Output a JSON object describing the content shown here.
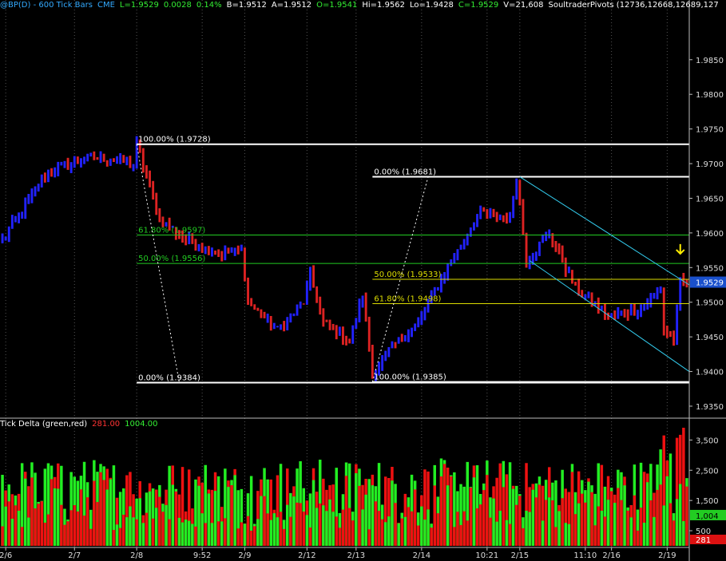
{
  "header": {
    "symbol": "@BP(D) - 600 Tick Bars",
    "exchange": "CME",
    "last": "L=1.9529",
    "change": "0.0028",
    "change_pct": "0.14%",
    "bid": "B=1.9512",
    "ask": "A=1.9512",
    "open": "O=1.9541",
    "high": "Hi=1.9562",
    "low": "Lo=1.9428",
    "close": "C=1.9529",
    "volume": "V=21,608",
    "pivots": "SoultraderPivots (12736,12668,12689,127"
  },
  "indicator_header": {
    "name": "Tick Delta (green,red)",
    "red_value": "281.00",
    "green_value": "1004.00"
  },
  "colors": {
    "up_bar": "#2222ff",
    "down_bar": "#dd2222",
    "delta_green": "#22ee22",
    "delta_red": "#ee1111",
    "white_line": "#ffffff",
    "green_line": "#22cc22",
    "yellow_line": "#dddd00",
    "channel": "#33ccee",
    "arrow": "#ffee00"
  },
  "chart_data": [
    {
      "type": "bar",
      "title": "@BP(D) - 600 Tick Bars",
      "ylim": [
        1.9335,
        1.992
      ],
      "y_ticks": [
        "1.9850",
        "1.9800",
        "1.9750",
        "1.9700",
        "1.9650",
        "1.9600",
        "1.9550",
        "1.9500",
        "1.9450",
        "1.9400",
        "1.9350"
      ],
      "last_price_tag": "1.9529",
      "x_ticks": [
        "2/6",
        "2/7",
        "2/8",
        "9:52",
        "2/9",
        "2/12",
        "2/13",
        "2/14",
        "10:21",
        "2/15",
        "11:10",
        "2/16",
        "2/19"
      ],
      "anchors": [
        {
          "bar": 0,
          "price": 1.959
        },
        {
          "bar": 14,
          "price": 1.969
        },
        {
          "bar": 28,
          "price": 1.971
        },
        {
          "bar": 40,
          "price": 1.97
        },
        {
          "bar": 41,
          "price": 1.9728
        },
        {
          "bar": 48,
          "price": 1.962
        },
        {
          "bar": 56,
          "price": 1.959
        },
        {
          "bar": 66,
          "price": 1.957
        },
        {
          "bar": 73,
          "price": 1.9575
        },
        {
          "bar": 75,
          "price": 1.95
        },
        {
          "bar": 84,
          "price": 1.946
        },
        {
          "bar": 92,
          "price": 1.95
        },
        {
          "bar": 94,
          "price": 1.954
        },
        {
          "bar": 98,
          "price": 1.947
        },
        {
          "bar": 106,
          "price": 1.9445
        },
        {
          "bar": 110,
          "price": 1.951
        },
        {
          "bar": 113,
          "price": 1.9395
        },
        {
          "bar": 118,
          "price": 1.943
        },
        {
          "bar": 127,
          "price": 1.947
        },
        {
          "bar": 136,
          "price": 1.955
        },
        {
          "bar": 146,
          "price": 1.963
        },
        {
          "bar": 155,
          "price": 1.962
        },
        {
          "bar": 157,
          "price": 1.9681
        },
        {
          "bar": 160,
          "price": 1.956
        },
        {
          "bar": 167,
          "price": 1.96
        },
        {
          "bar": 175,
          "price": 1.952
        },
        {
          "bar": 185,
          "price": 1.948
        },
        {
          "bar": 195,
          "price": 1.949
        },
        {
          "bar": 201,
          "price": 1.952
        },
        {
          "bar": 202,
          "price": 1.946
        },
        {
          "bar": 205,
          "price": 1.9445
        },
        {
          "bar": 207,
          "price": 1.9529
        }
      ],
      "fib_retracements": [
        {
          "label": "100.00% (1.9728)",
          "price": 1.9728,
          "color": "white",
          "from_bar": 41
        },
        {
          "label": "61.80% (1.9597)",
          "price": 1.9597,
          "color": "green",
          "from_bar": 41
        },
        {
          "label": "50.00% (1.9556)",
          "price": 1.9556,
          "color": "green",
          "from_bar": 41
        },
        {
          "label": "0.00% (1.9384)",
          "price": 1.9384,
          "color": "white",
          "from_bar": 41
        },
        {
          "label": "0.00% (1.9681)",
          "price": 1.9681,
          "color": "white",
          "from_bar": 113
        },
        {
          "label": "50.00% (1.9533)",
          "price": 1.9533,
          "color": "yellow",
          "from_bar": 113
        },
        {
          "label": "61.80% (1.9498)",
          "price": 1.9498,
          "color": "yellow",
          "from_bar": 113
        },
        {
          "label": "100.00% (1.9385)",
          "price": 1.9385,
          "color": "white",
          "from_bar": 113
        }
      ],
      "fib_swing_lines": [
        {
          "from": {
            "bar": 41,
            "price": 1.9728
          },
          "to": {
            "bar": 54,
            "price": 1.9384
          }
        },
        {
          "from": {
            "bar": 113,
            "price": 1.9385
          },
          "to": {
            "bar": 130,
            "price": 1.9681
          }
        }
      ],
      "channel_lines": [
        {
          "from": {
            "bar": 158,
            "price": 1.9681
          },
          "to": {
            "bar": 216,
            "price": 1.9525
          }
        },
        {
          "from": {
            "bar": 161,
            "price": 1.956
          },
          "to": {
            "bar": 216,
            "price": 1.94
          }
        }
      ],
      "marker": {
        "type": "down-arrow",
        "bar": 207,
        "price": 1.957
      }
    },
    {
      "type": "bar",
      "title": "Tick Delta (green,red)",
      "ylim": [
        0,
        3800
      ],
      "y_ticks": [
        "3,500",
        "2,500",
        "1,500",
        "500"
      ],
      "last_green_tag": "1,004",
      "last_red_tag": "281",
      "series": [
        {
          "name": "green"
        },
        {
          "name": "red"
        }
      ]
    }
  ]
}
